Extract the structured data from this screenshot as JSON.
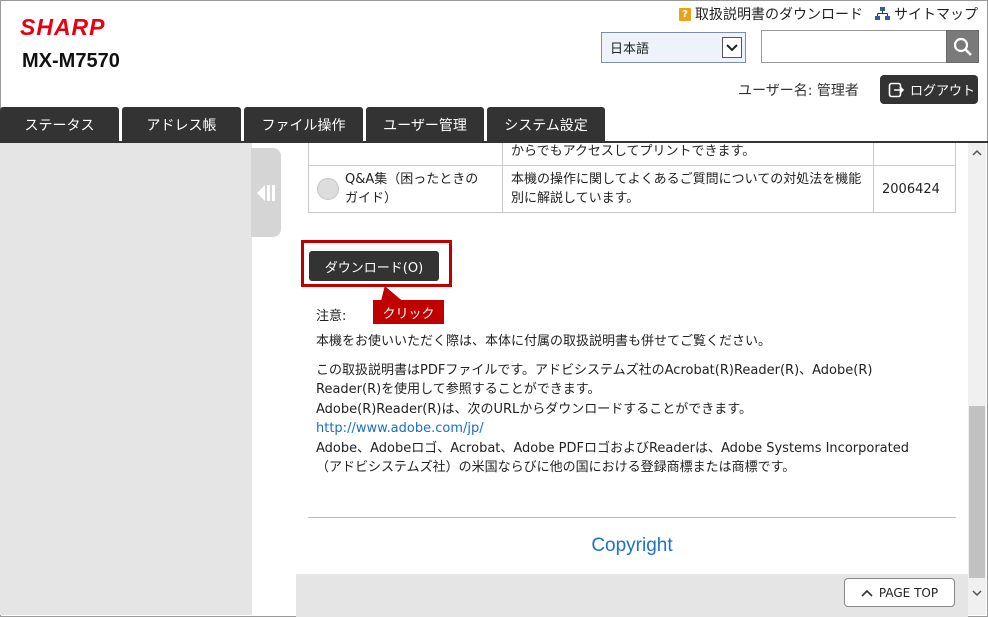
{
  "header": {
    "logo": "SHARP",
    "model": "MX-M7570",
    "manual_download_link": "取扱説明書のダウンロード",
    "sitemap_link": "サイトマップ",
    "language": "日本語",
    "search_placeholder": "",
    "username_label": "ユーザー名: 管理者",
    "logout_label": "ログアウト"
  },
  "nav": {
    "tabs": [
      "ステータス",
      "アドレス帳",
      "ファイル操作",
      "ユーザー管理",
      "システム設定"
    ]
  },
  "table": {
    "rows": [
      {
        "name": "",
        "description": "からでもアクセスしてプリントできます。",
        "number": ""
      },
      {
        "name": "Q&A集（困ったときのガイド）",
        "description": "本機の操作に関してよくあるご質問についての対処法を機能別に解説しています。",
        "number": "2006424"
      }
    ]
  },
  "download_button": "ダウンロード(O)",
  "callout": "クリック",
  "note": {
    "label": "注意:",
    "para1": "本機をお使いいただく際は、本体に付属の取扱説明書も併せてご覧ください。",
    "para2_line1": "この取扱説明書はPDFファイルです。アドビシステムズ社のAcrobat(R)Reader(R)、Adobe(R)",
    "para2_line2": "Reader(R)を使用して参照することができます。",
    "para2_line3": "Adobe(R)Reader(R)は、次のURLからダウンロードすることができます。",
    "url": "http://www.adobe.com/jp/",
    "trademark_line1": "Adobe、Adobeロゴ、Acrobat、Adobe PDFロゴおよびReaderは、Adobe Systems Incorporated",
    "trademark_line2": "（アドビシステムズ社）の米国ならびに他の国における登録商標または商標です。"
  },
  "footer": {
    "copyright": "Copyright",
    "page_top": "PAGE TOP"
  },
  "colors": {
    "brand": "#e60012",
    "highlight": "#c00000",
    "link": "#1a6ec8",
    "tab_bg": "#333333"
  }
}
